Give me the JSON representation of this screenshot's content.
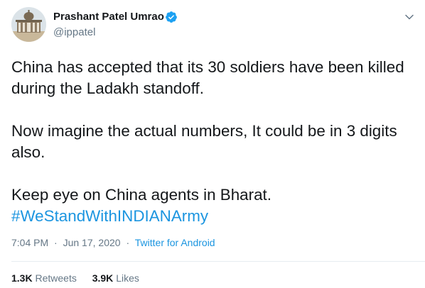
{
  "author": {
    "name": "Prashant Patel Umrao",
    "handle": "@ippatel",
    "verified": true
  },
  "tweet": {
    "line1": "China has accepted that its 30 soldiers have been killed during the Ladakh standoff.",
    "line2": "Now imagine the actual numbers, It could be in 3 digits also.",
    "line3": "Keep eye on China agents in Bharat.",
    "hashtag": "#WeStandWithINDIANArmy"
  },
  "meta": {
    "time": "7:04 PM",
    "separator": "·",
    "date": "Jun 17, 2020",
    "source": "Twitter for Android"
  },
  "stats": {
    "retweets_count": "1.3K",
    "retweets_label": "Retweets",
    "likes_count": "3.9K",
    "likes_label": "Likes"
  },
  "colors": {
    "link": "#1b95e0",
    "secondary_text": "#657786",
    "primary_text": "#14171a",
    "verified_badge": "#1da1f2"
  },
  "icons": {
    "verified": "verified-badge-icon",
    "caret": "chevron-down-icon"
  }
}
